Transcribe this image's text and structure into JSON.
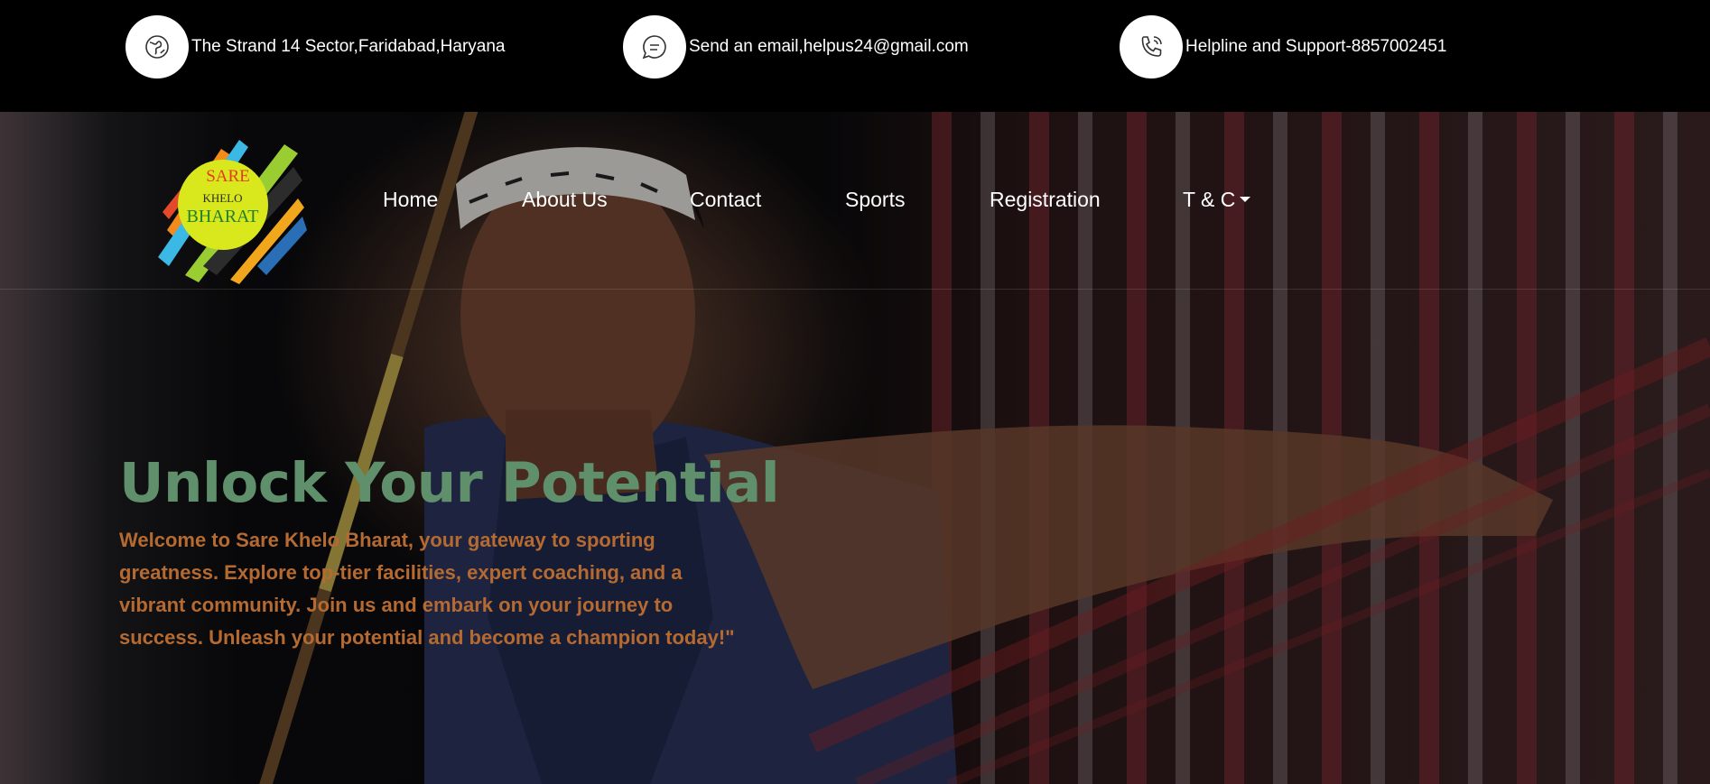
{
  "topbar": {
    "address": {
      "icon": "globe-icon",
      "text": "The Strand 14 Sector,Faridabad,Haryana"
    },
    "email": {
      "icon": "message-icon",
      "text": "Send an email,helpus24@gmail.com"
    },
    "phone": {
      "icon": "phone-icon",
      "text": "Helpline and Support-8857002451"
    }
  },
  "logo": {
    "line1": "SARE",
    "line2": "KHELO",
    "line3": "BHARAT"
  },
  "nav": {
    "items": [
      {
        "label": "Home"
      },
      {
        "label": "About Us"
      },
      {
        "label": "Contact"
      },
      {
        "label": "Sports"
      },
      {
        "label": "Registration"
      },
      {
        "label": "T & C"
      }
    ]
  },
  "hero": {
    "headline": "Unlock Your Potential",
    "paragraph": "Welcome to Sare Khelo Bharat, your gateway to sporting greatness. Explore top-tier facilities, expert coaching, and a vibrant community. Join us and embark on your journey to success. Unleash your potential and become a champion today!\""
  },
  "colors": {
    "headline": "#5f8f6b",
    "paragraph": "#b56a32",
    "topbar_bg": "#000000"
  }
}
